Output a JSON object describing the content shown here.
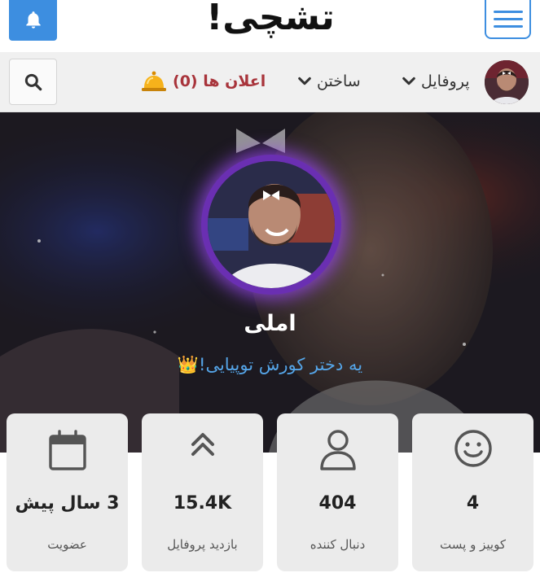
{
  "header": {
    "logo_text": "تشچی!",
    "bell_icon": "bell-icon",
    "menu_icon": "hamburger-menu-icon",
    "accent": "#3d8ee0"
  },
  "nav": {
    "search_icon": "search-icon",
    "notifications_label": "اعلان ها (0)",
    "notifications_icon": "service-bell-icon",
    "build_label": "ساختن",
    "profile_label": "پروفایل"
  },
  "profile": {
    "name": "املی",
    "bio": "یه دختر کورش توپیایی!👑",
    "ring_color": "#9a48f0"
  },
  "stats": [
    {
      "label": "کوییز و پست",
      "value": "4",
      "icon": "smiley-icon"
    },
    {
      "label": "دنبال کننده",
      "value": "404",
      "icon": "user-icon"
    },
    {
      "label": "بازدید پروفایل",
      "value": "15.4K",
      "icon": "double-chevron-up-icon"
    },
    {
      "label": "عضویت",
      "value": "3 سال پیش",
      "icon": "calendar-icon"
    }
  ]
}
